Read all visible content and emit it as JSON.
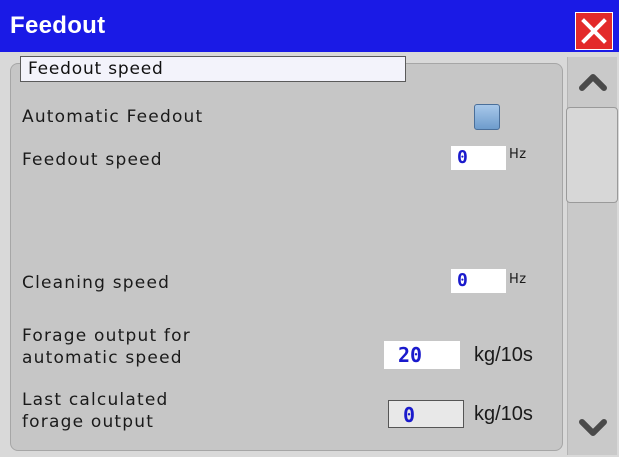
{
  "window": {
    "title": "Feedout"
  },
  "colors": {
    "titlebar": "#1a1ae6",
    "close": "#e32a2a",
    "value_text": "#1a1acc"
  },
  "icons": {
    "close": "close-icon",
    "scroll_up": "chevron-up-icon",
    "scroll_down": "chevron-down-icon"
  },
  "panel": {
    "tab_label": "Feedout speed",
    "automatic_feedout": {
      "label": "Automatic Feedout",
      "checked": false
    },
    "feedout_speed": {
      "label": "Feedout speed",
      "value": "0",
      "unit": "Hz"
    },
    "cleaning_speed": {
      "label": "Cleaning speed",
      "value": "0",
      "unit": "Hz"
    },
    "forage_output_auto": {
      "label_line1": "Forage output for",
      "label_line2": "automatic speed",
      "value": "20",
      "unit": "kg/10s"
    },
    "last_calculated": {
      "label_line1": "Last calculated",
      "label_line2": "forage output",
      "value": "0",
      "unit": "kg/10s"
    }
  }
}
